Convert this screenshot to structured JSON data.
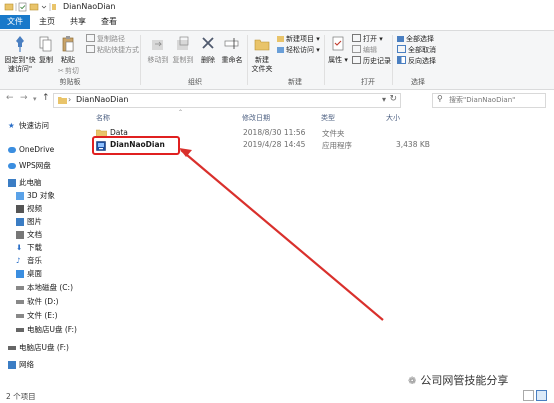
{
  "window": {
    "title": "DianNaoDian"
  },
  "tabs": [
    {
      "label": "文件",
      "active": true
    },
    {
      "label": "主页",
      "active": false
    },
    {
      "label": "共享",
      "active": false
    },
    {
      "label": "查看",
      "active": false
    }
  ],
  "ribbon": {
    "clipboard": {
      "group_label": "剪贴板",
      "pin_label_line1": "固定到\"快",
      "pin_label_line2": "速访问\"",
      "copy_label": "复制",
      "paste_label": "粘贴",
      "copy_path": "复制路径",
      "paste_shortcut": "粘贴快捷方式",
      "cut": "剪切"
    },
    "organize": {
      "group_label": "组织",
      "move_to": "移动到",
      "copy_to": "复制到",
      "delete": "删除",
      "rename": "重命名"
    },
    "new": {
      "group_label": "新建",
      "new_folder_line1": "新建",
      "new_folder_line2": "文件夹",
      "new_item": "新建项目",
      "easy_access": "轻松访问"
    },
    "open": {
      "group_label": "打开",
      "properties": "属性",
      "open": "打开",
      "edit": "编辑",
      "history": "历史记录"
    },
    "select": {
      "group_label": "选择",
      "select_all": "全部选择",
      "select_none": "全部取消",
      "invert": "反向选择"
    }
  },
  "address": {
    "path": "DianNaoDian",
    "search_placeholder": "搜索\"DianNaoDian\""
  },
  "nav": {
    "items": [
      {
        "label": "快速访问",
        "icon": "star-icon",
        "indent": 0
      },
      {
        "label": "OneDrive",
        "icon": "cloud-icon",
        "indent": 0
      },
      {
        "label": "WPS网盘",
        "icon": "cloud-icon",
        "indent": 0
      },
      {
        "label": "此电脑",
        "icon": "computer-icon",
        "indent": 0
      },
      {
        "label": "3D 对象",
        "icon": "cube-icon",
        "indent": 1
      },
      {
        "label": "视频",
        "icon": "video-icon",
        "indent": 1
      },
      {
        "label": "图片",
        "icon": "picture-icon",
        "indent": 1
      },
      {
        "label": "文档",
        "icon": "document-icon",
        "indent": 1
      },
      {
        "label": "下载",
        "icon": "download-icon",
        "indent": 1
      },
      {
        "label": "音乐",
        "icon": "music-icon",
        "indent": 1
      },
      {
        "label": "桌面",
        "icon": "desktop-icon",
        "indent": 1
      },
      {
        "label": "本地磁盘 (C:)",
        "icon": "drive-icon",
        "indent": 1
      },
      {
        "label": "软件 (D:)",
        "icon": "drive-icon",
        "indent": 1
      },
      {
        "label": "文件 (E:)",
        "icon": "drive-icon",
        "indent": 1
      },
      {
        "label": "电脑店U盘 (F:)",
        "icon": "usb-drive-icon",
        "indent": 1
      },
      {
        "label": "电脑店U盘 (F:)",
        "icon": "usb-drive-icon",
        "indent": 0
      },
      {
        "label": "网络",
        "icon": "network-icon",
        "indent": 0
      }
    ]
  },
  "columns": {
    "name": "名称",
    "modified": "修改日期",
    "type": "类型",
    "size": "大小"
  },
  "files": [
    {
      "name": "Data",
      "modified": "2018/8/30 11:56",
      "type": "文件夹",
      "size": "",
      "icon": "folder-icon"
    },
    {
      "name": "DianNaoDian",
      "modified": "2019/4/28 14:45",
      "type": "应用程序",
      "size": "3,438 KB",
      "icon": "app-icon"
    }
  ],
  "status": {
    "count": "2 个项目"
  },
  "watermark": "公司网管技能分享",
  "colors": {
    "accent": "#1979ca",
    "highlight": "#e02020",
    "arrow": "#d9302c"
  }
}
